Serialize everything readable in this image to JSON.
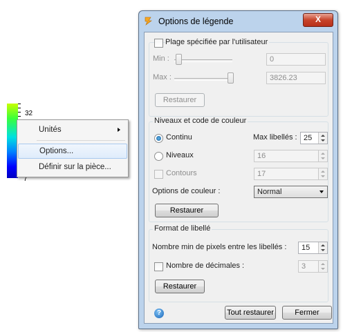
{
  "legend": {
    "top_value": "32",
    "bottom_value": "7"
  },
  "context_menu": {
    "items": [
      {
        "label": "Unités"
      },
      {
        "label": "Options..."
      },
      {
        "label": "Définir sur la pièce..."
      }
    ]
  },
  "dialog": {
    "title": "Options de légende",
    "close_label": "X",
    "range_group": {
      "checkbox_label": "Plage spécifiée par l'utilisateur",
      "min_label": "Min :",
      "min_value": "0",
      "max_label": "Max :",
      "max_value": "3826.23",
      "reset_label": "Restaurer"
    },
    "levels_group": {
      "title": "Niveaux et code de couleur",
      "continu_label": "Continu",
      "max_labels_label": "Max libellés :",
      "max_labels_value": "25",
      "niveaux_label": "Niveaux",
      "niveaux_value": "16",
      "contours_label": "Contours",
      "contours_value": "17",
      "color_options_label": "Options de couleur :",
      "color_options_value": "Normal",
      "reset_label": "Restaurer"
    },
    "format_group": {
      "title": "Format de libellé",
      "min_pixels_label": "Nombre min de pixels entre les libellés :",
      "min_pixels_value": "15",
      "decimals_label": "Nombre de décimales :",
      "decimals_value": "3",
      "reset_label": "Restaurer"
    },
    "footer": {
      "reset_all_label": "Tout restaurer",
      "close_label": "Fermer"
    }
  }
}
